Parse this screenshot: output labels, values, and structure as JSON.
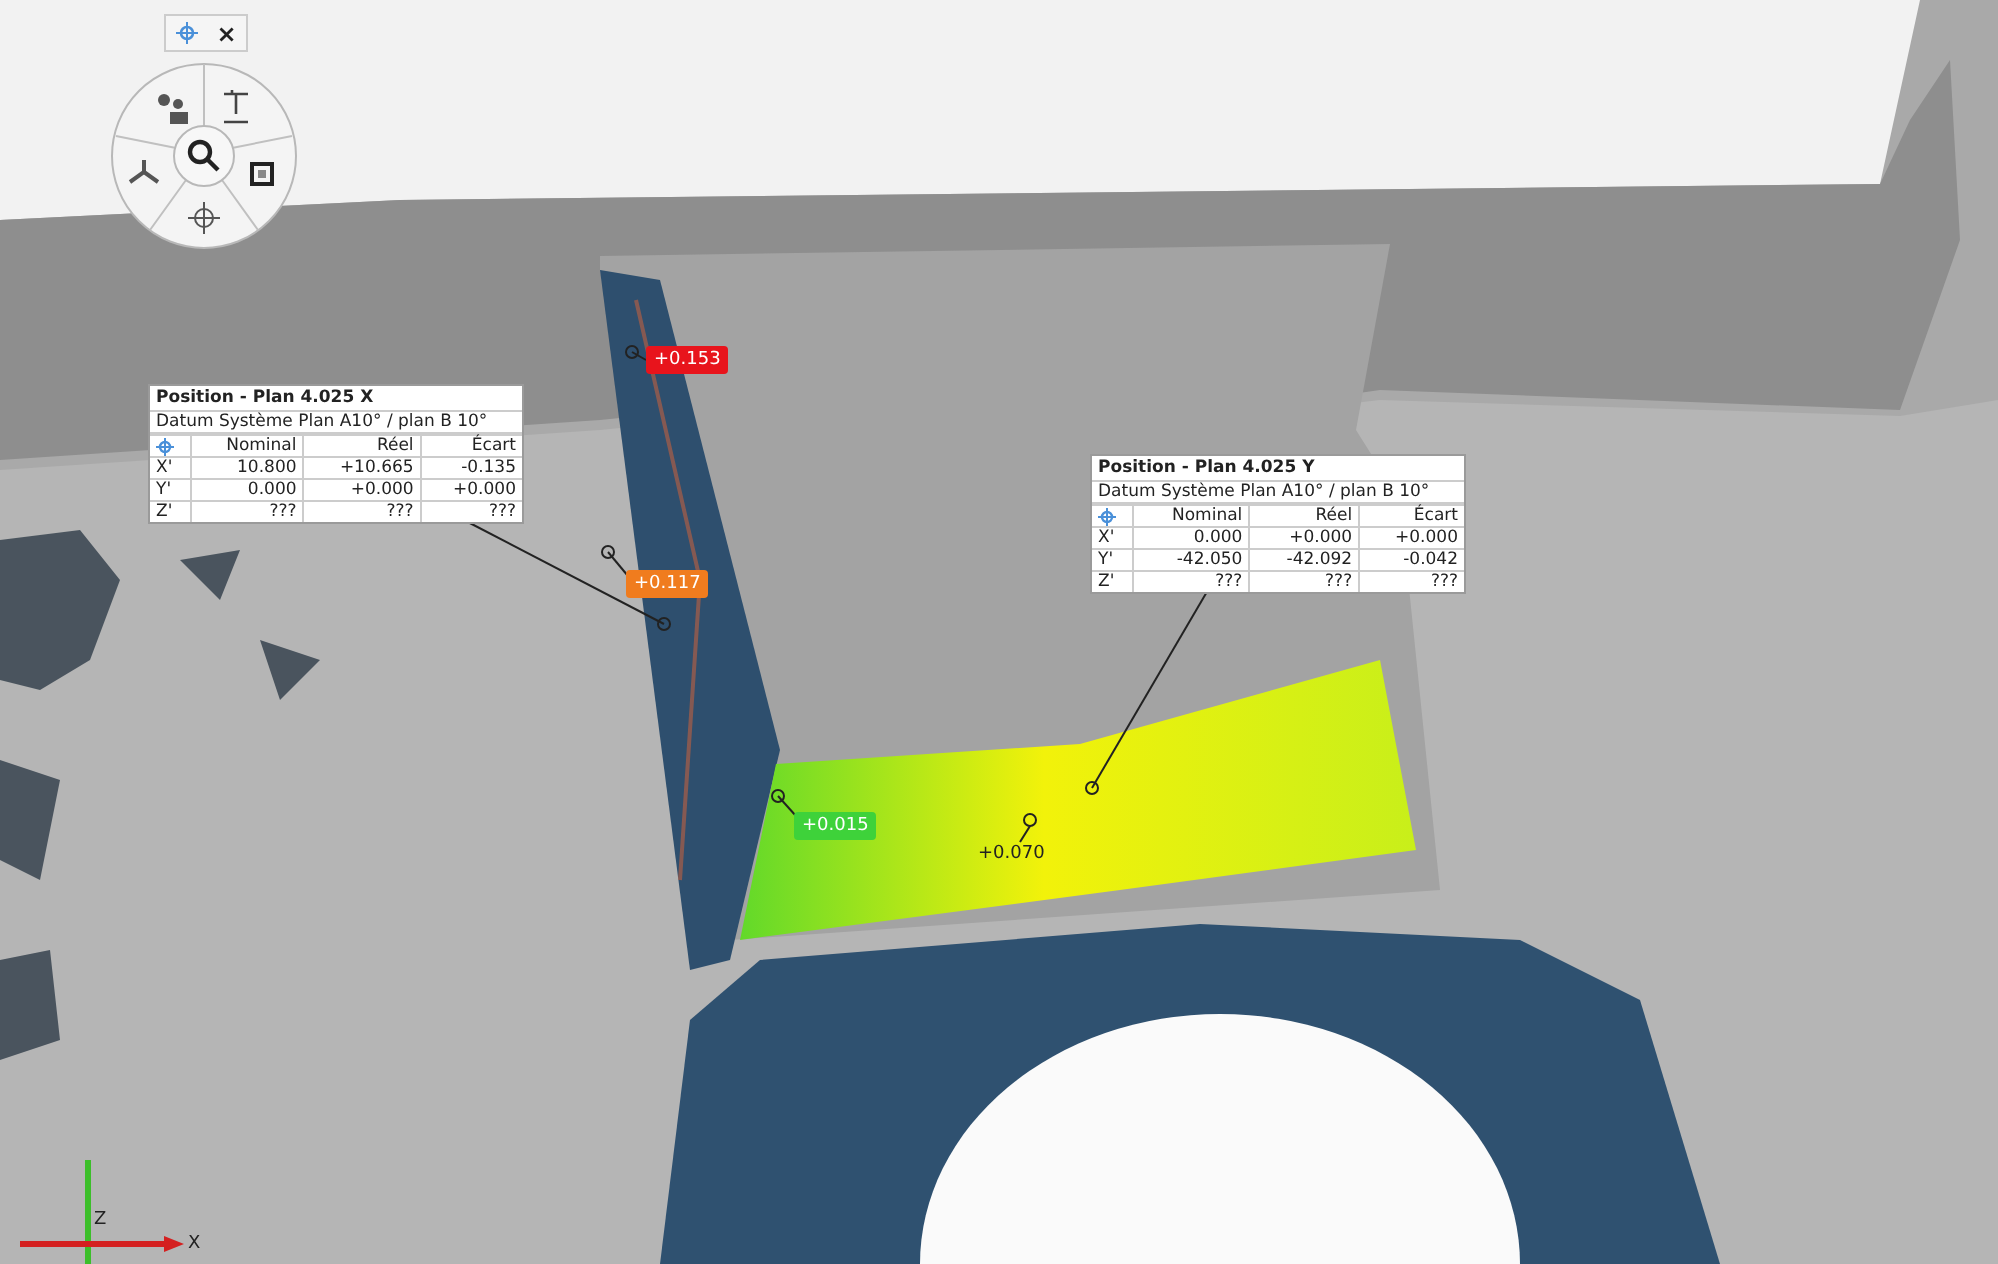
{
  "view_toolbar": {
    "close": "×"
  },
  "callouts": [
    {
      "title": "Position - Plan 4.025 X",
      "subtitle": "Datum Système Plan A10° / plan B 10°",
      "columns": [
        "Nominal",
        "Réel",
        "Écart"
      ],
      "rows": [
        {
          "axis": "X'",
          "values": [
            "10.800",
            "+10.665",
            "-0.135"
          ]
        },
        {
          "axis": "Y'",
          "values": [
            "0.000",
            "+0.000",
            "+0.000"
          ]
        },
        {
          "axis": "Z'",
          "values": [
            "???",
            "???",
            "???"
          ]
        }
      ]
    },
    {
      "title": "Position - Plan 4.025 Y",
      "subtitle": "Datum Système Plan A10° / plan B 10°",
      "columns": [
        "Nominal",
        "Réel",
        "Écart"
      ],
      "rows": [
        {
          "axis": "X'",
          "values": [
            "0.000",
            "+0.000",
            "+0.000"
          ]
        },
        {
          "axis": "Y'",
          "values": [
            "-42.050",
            "-42.092",
            "-0.042"
          ]
        },
        {
          "axis": "Z'",
          "values": [
            "???",
            "???",
            "???"
          ]
        }
      ]
    }
  ],
  "deviation_labels": [
    {
      "value": "+0.153",
      "color": "#e8141c"
    },
    {
      "value": "+0.117",
      "color": "#f07c1e"
    },
    {
      "value": "+0.015",
      "color": "#3ed23a"
    },
    {
      "value": "+0.070"
    }
  ],
  "axes": {
    "vertical": "Z",
    "horizontal": "X"
  }
}
